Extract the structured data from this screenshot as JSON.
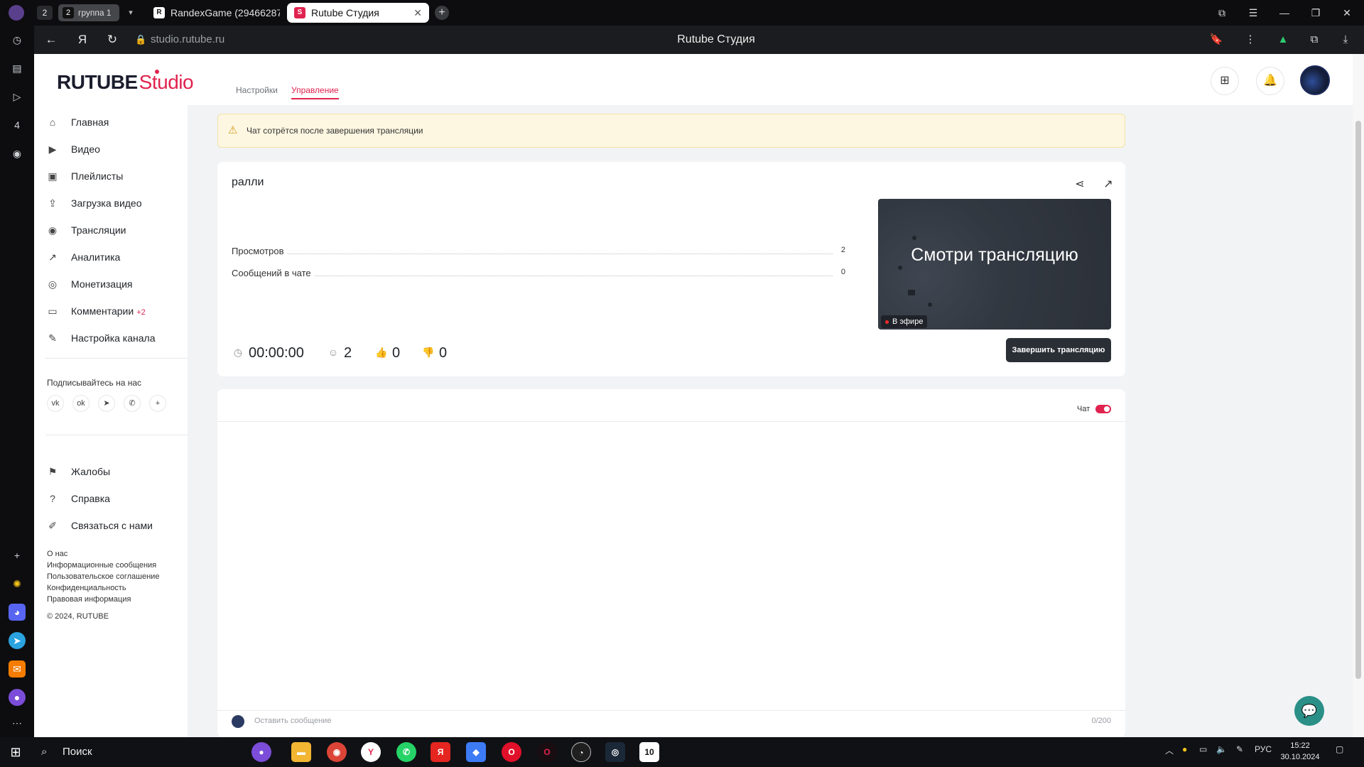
{
  "browser": {
    "tab_count": "2",
    "tab_group": {
      "number": "2",
      "label": "группа 1"
    },
    "tabs": [
      {
        "label": "RandexGame (29466287)",
        "favicon": "R"
      },
      {
        "label": "Rutube Студия",
        "favicon": "S"
      }
    ],
    "url": "studio.rutube.ru",
    "page_title": "Rutube Студия"
  },
  "header": {
    "logo_main": "RUTUBE",
    "logo_studio": "Studio"
  },
  "sidebar": {
    "items": [
      {
        "label": "Главная",
        "icon": "home-icon"
      },
      {
        "label": "Видео",
        "icon": "video-icon"
      },
      {
        "label": "Плейлисты",
        "icon": "playlist-icon"
      },
      {
        "label": "Загрузка видео",
        "icon": "upload-icon"
      },
      {
        "label": "Трансляции",
        "icon": "broadcast-icon"
      },
      {
        "label": "Аналитика",
        "icon": "analytics-icon"
      },
      {
        "label": "Монетизация",
        "icon": "money-icon"
      },
      {
        "label": "Комментарии",
        "icon": "comments-icon",
        "badge": "+2"
      },
      {
        "label": "Настройка канала",
        "icon": "wand-icon"
      }
    ],
    "follow_label": "Подписывайтесь на нас",
    "socials": [
      "vk",
      "ok",
      "telegram",
      "viber",
      "more"
    ],
    "bottom_items": [
      {
        "label": "Жалобы",
        "icon": "flag-icon"
      },
      {
        "label": "Справка",
        "icon": "help-icon"
      },
      {
        "label": "Связаться с нами",
        "icon": "pen-icon"
      }
    ],
    "footer_links": [
      "О нас",
      "Информационные сообщения",
      "Пользовательское соглашение",
      "Конфиденциальность",
      "Правовая информация"
    ],
    "copyright": "© 2024, RUTUBE"
  },
  "content": {
    "tabs": [
      {
        "label": "Настройки",
        "active": false
      },
      {
        "label": "Управление",
        "active": true
      }
    ],
    "warning": "Чат сотрётся после завершения трансляции",
    "stream": {
      "title": "ралли",
      "stats": [
        {
          "label": "Просмотров",
          "value": "2"
        },
        {
          "label": "Сообщений в чате",
          "value": "0"
        }
      ],
      "preview_text": "Смотри трансляцию",
      "live_badge": "В эфире",
      "duration": "00:00:00",
      "viewers": "2",
      "likes": "0",
      "dislikes": "0",
      "end_button": "Завершить трансляцию"
    },
    "chat": {
      "label": "Чат",
      "enabled": true,
      "input_placeholder": "Оставить сообщение",
      "char_count": "0/200"
    }
  },
  "taskbar": {
    "search_label": "Поиск",
    "apps": [
      "alice",
      "explorer",
      "chrome",
      "yandex-browser",
      "whatsapp",
      "yandex",
      "app",
      "opera",
      "opera-gx",
      "chart-app",
      "steam",
      "app-10"
    ],
    "language": "РУС",
    "time": "15:22",
    "date": "30.10.2024"
  },
  "colors": {
    "accent": "#e0234e",
    "end_button": "#2a2f36",
    "warning_bg": "#fdf7e1",
    "support": "#2a8f87"
  }
}
